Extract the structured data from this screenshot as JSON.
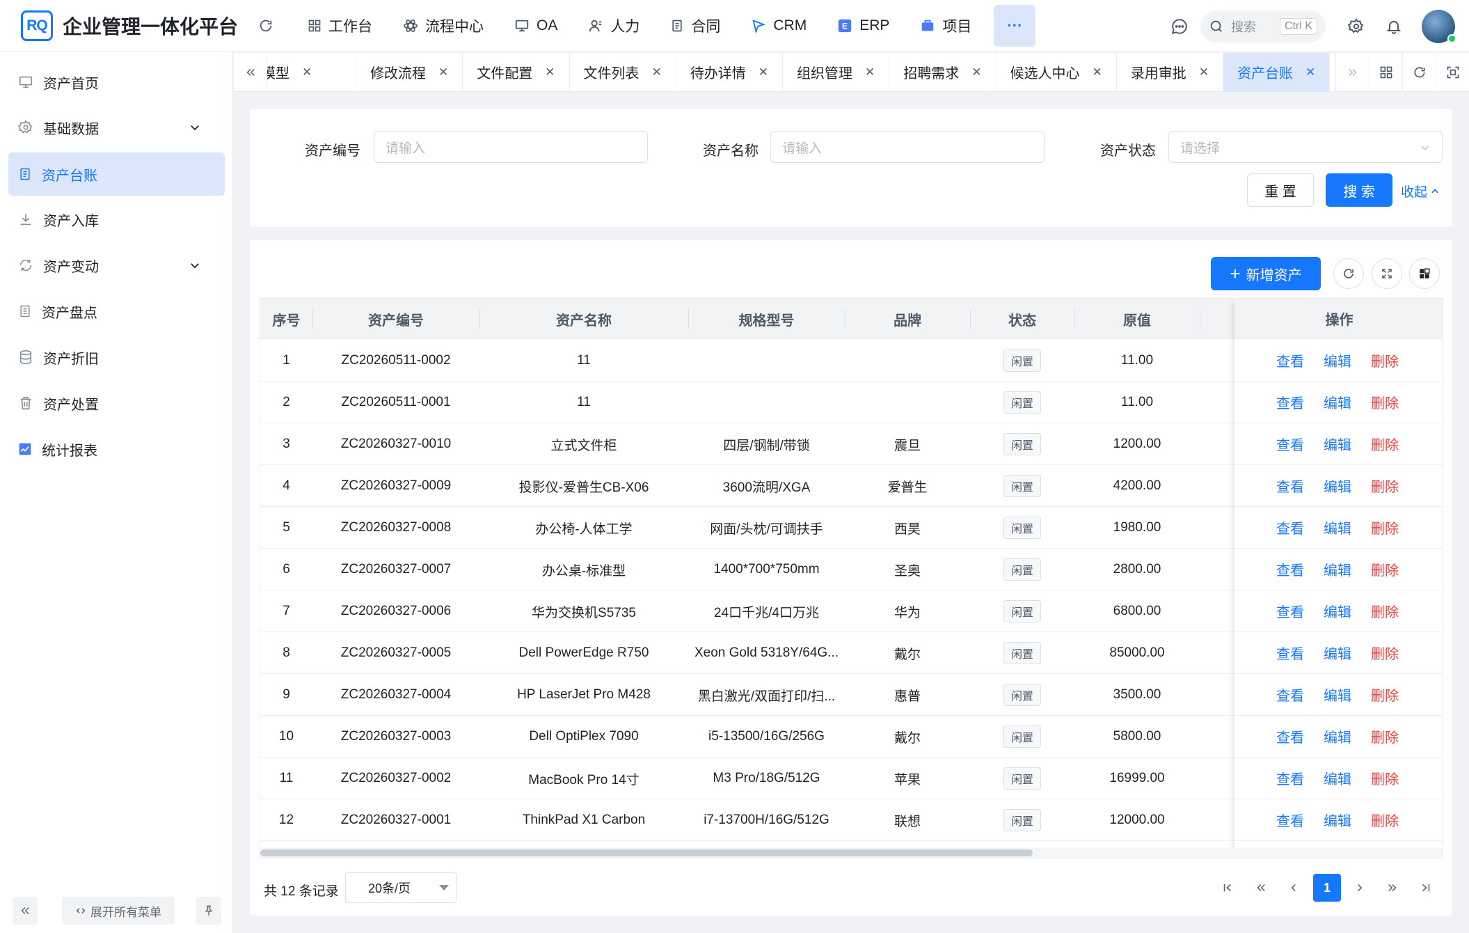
{
  "app": {
    "logo_mark": "RQ",
    "title": "企业管理一体化平台"
  },
  "nav": [
    {
      "label": "工作台",
      "icon": "grid-icon"
    },
    {
      "label": "流程中心",
      "icon": "atom-icon"
    },
    {
      "label": "OA",
      "icon": "monitor-icon"
    },
    {
      "label": "人力",
      "icon": "user-icon"
    },
    {
      "label": "合同",
      "icon": "document-icon"
    },
    {
      "label": "CRM",
      "icon": "flag-icon"
    },
    {
      "label": "ERP",
      "icon": "erp-icon"
    },
    {
      "label": "项目",
      "icon": "briefcase-icon"
    }
  ],
  "nav_more": "···",
  "search": {
    "placeholder": "搜索",
    "shortcut": "Ctrl K"
  },
  "sidebar": {
    "items": [
      {
        "label": "资产首页",
        "icon": "monitor-icon",
        "expandable": false,
        "active": false
      },
      {
        "label": "基础数据",
        "icon": "gear-icon",
        "expandable": true,
        "active": false
      },
      {
        "label": "资产台账",
        "icon": "file-icon",
        "expandable": false,
        "active": true
      },
      {
        "label": "资产入库",
        "icon": "download-icon",
        "expandable": false,
        "active": false
      },
      {
        "label": "资产变动",
        "icon": "sync-icon",
        "expandable": true,
        "active": false
      },
      {
        "label": "资产盘点",
        "icon": "list-icon",
        "expandable": false,
        "active": false
      },
      {
        "label": "资产折旧",
        "icon": "database-icon",
        "expandable": false,
        "active": false
      },
      {
        "label": "资产处置",
        "icon": "trash-icon",
        "expandable": false,
        "active": false
      },
      {
        "label": "统计报表",
        "icon": "chart-icon",
        "expandable": false,
        "active": false
      }
    ],
    "expand_all_label": "展开所有菜单"
  },
  "tabs": [
    {
      "label": "模型",
      "active": false,
      "partial": true
    },
    {
      "label": "修改流程",
      "active": false
    },
    {
      "label": "文件配置",
      "active": false
    },
    {
      "label": "文件列表",
      "active": false
    },
    {
      "label": "待办详情",
      "active": false
    },
    {
      "label": "组织管理",
      "active": false
    },
    {
      "label": "招聘需求",
      "active": false
    },
    {
      "label": "候选人中心",
      "active": false
    },
    {
      "label": "录用审批",
      "active": false
    },
    {
      "label": "资产台账",
      "active": true
    }
  ],
  "filter": {
    "asset_no": {
      "label": "资产编号",
      "placeholder": "请输入"
    },
    "asset_name": {
      "label": "资产名称",
      "placeholder": "请输入"
    },
    "asset_status": {
      "label": "资产状态",
      "placeholder": "请选择"
    },
    "reset_label": "重 置",
    "search_label": "搜 索",
    "collapse_label": "收起"
  },
  "toolbar": {
    "add_label": "新增资产"
  },
  "table": {
    "columns": [
      "序号",
      "资产编号",
      "资产名称",
      "规格型号",
      "品牌",
      "状态",
      "原值",
      "操作"
    ],
    "actions": {
      "view": "查看",
      "edit": "编辑",
      "delete": "删除"
    },
    "rows": [
      {
        "no": "1",
        "code": "ZC20260511-0002",
        "name": "11",
        "spec": "",
        "brand": "",
        "status": "闲置",
        "value": "11.00"
      },
      {
        "no": "2",
        "code": "ZC20260511-0001",
        "name": "11",
        "spec": "",
        "brand": "",
        "status": "闲置",
        "value": "11.00"
      },
      {
        "no": "3",
        "code": "ZC20260327-0010",
        "name": "立式文件柜",
        "spec": "四层/钢制/带锁",
        "brand": "震旦",
        "status": "闲置",
        "value": "1200.00"
      },
      {
        "no": "4",
        "code": "ZC20260327-0009",
        "name": "投影仪-爱普生CB-X06",
        "spec": "3600流明/XGA",
        "brand": "爱普生",
        "status": "闲置",
        "value": "4200.00"
      },
      {
        "no": "5",
        "code": "ZC20260327-0008",
        "name": "办公椅-人体工学",
        "spec": "网面/头枕/可调扶手",
        "brand": "西昊",
        "status": "闲置",
        "value": "1980.00"
      },
      {
        "no": "6",
        "code": "ZC20260327-0007",
        "name": "办公桌-标准型",
        "spec": "1400*700*750mm",
        "brand": "圣奥",
        "status": "闲置",
        "value": "2800.00"
      },
      {
        "no": "7",
        "code": "ZC20260327-0006",
        "name": "华为交换机S5735",
        "spec": "24口千兆/4口万兆",
        "brand": "华为",
        "status": "闲置",
        "value": "6800.00"
      },
      {
        "no": "8",
        "code": "ZC20260327-0005",
        "name": "Dell PowerEdge R750",
        "spec": "Xeon Gold 5318Y/64G...",
        "brand": "戴尔",
        "status": "闲置",
        "value": "85000.00"
      },
      {
        "no": "9",
        "code": "ZC20260327-0004",
        "name": "HP LaserJet Pro M428",
        "spec": "黑白激光/双面打印/扫...",
        "brand": "惠普",
        "status": "闲置",
        "value": "3500.00"
      },
      {
        "no": "10",
        "code": "ZC20260327-0003",
        "name": "Dell OptiPlex 7090",
        "spec": "i5-13500/16G/256G",
        "brand": "戴尔",
        "status": "闲置",
        "value": "5800.00"
      },
      {
        "no": "11",
        "code": "ZC20260327-0002",
        "name": "MacBook Pro 14寸",
        "spec": "M3 Pro/18G/512G",
        "brand": "苹果",
        "status": "闲置",
        "value": "16999.00"
      },
      {
        "no": "12",
        "code": "ZC20260327-0001",
        "name": "ThinkPad X1 Carbon",
        "spec": "i7-13700H/16G/512G",
        "brand": "联想",
        "status": "闲置",
        "value": "12000.00"
      }
    ]
  },
  "pagination": {
    "total_text": "共 12 条记录",
    "page_size": "20条/页",
    "current_page": "1"
  },
  "colors": {
    "primary": "#1677ff",
    "danger": "#f53f3f",
    "active_bg": "#dbe6fb"
  }
}
